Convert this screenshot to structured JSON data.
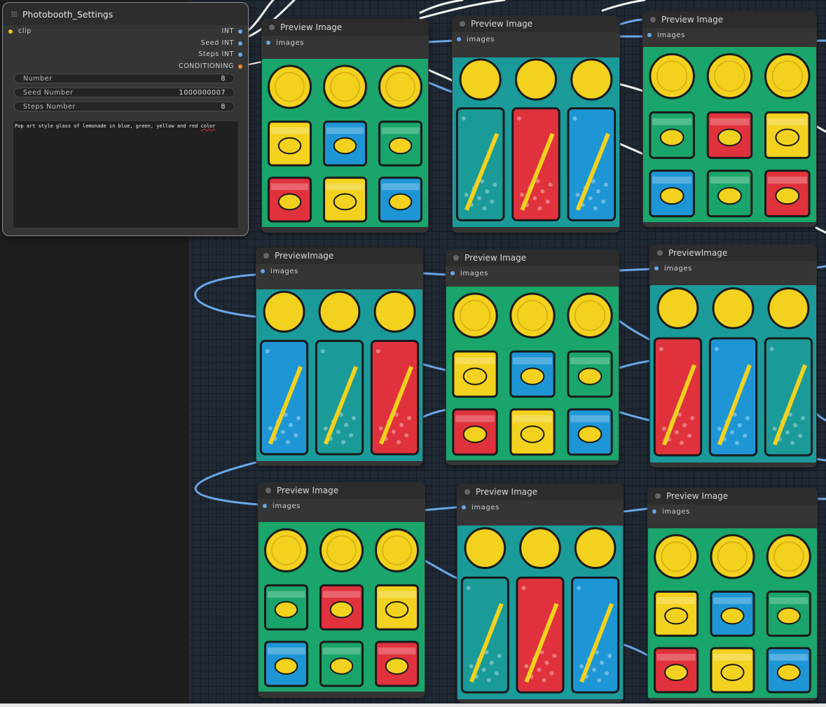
{
  "settings_node": {
    "title": "Photobooth_Settings",
    "input_clip": "clip",
    "outputs": [
      "INT",
      "Seed INT",
      "Steps INT",
      "CONDITIONING"
    ],
    "widgets": [
      {
        "label": "Number",
        "value": "8"
      },
      {
        "label": "Seed Number",
        "value": "1000000007"
      },
      {
        "label": "Steps Number",
        "value": "8"
      }
    ],
    "prompt_main": "Pop art style glass of lemonade in blue, green, yellow and red",
    "prompt_last_word": "color"
  },
  "preview_nodes": [
    {
      "title": "Preview Image",
      "port": "images"
    },
    {
      "title": "Preview Image",
      "port": "images"
    },
    {
      "title": "Preview Image",
      "port": "images"
    },
    {
      "title": "PreviewImage",
      "port": "images"
    },
    {
      "title": "Preview Image",
      "port": "images"
    },
    {
      "title": "PreviewImage",
      "port": "images"
    },
    {
      "title": "Preview Image",
      "port": "images"
    },
    {
      "title": "Preview Image",
      "port": "images"
    },
    {
      "title": "Preview Image",
      "port": "images"
    }
  ],
  "colors": {
    "wire_blue": "#6aa6e6",
    "wire_white": "#f2f2f2",
    "slot_yellow": "#e6c81e",
    "slot_orange": "#f08c28",
    "pop_green": "#19a56b",
    "pop_teal": "#1b9a9a",
    "lemon_yellow": "#f2d21e",
    "drink_red": "#e0323c",
    "drink_blue": "#1e96d6"
  }
}
